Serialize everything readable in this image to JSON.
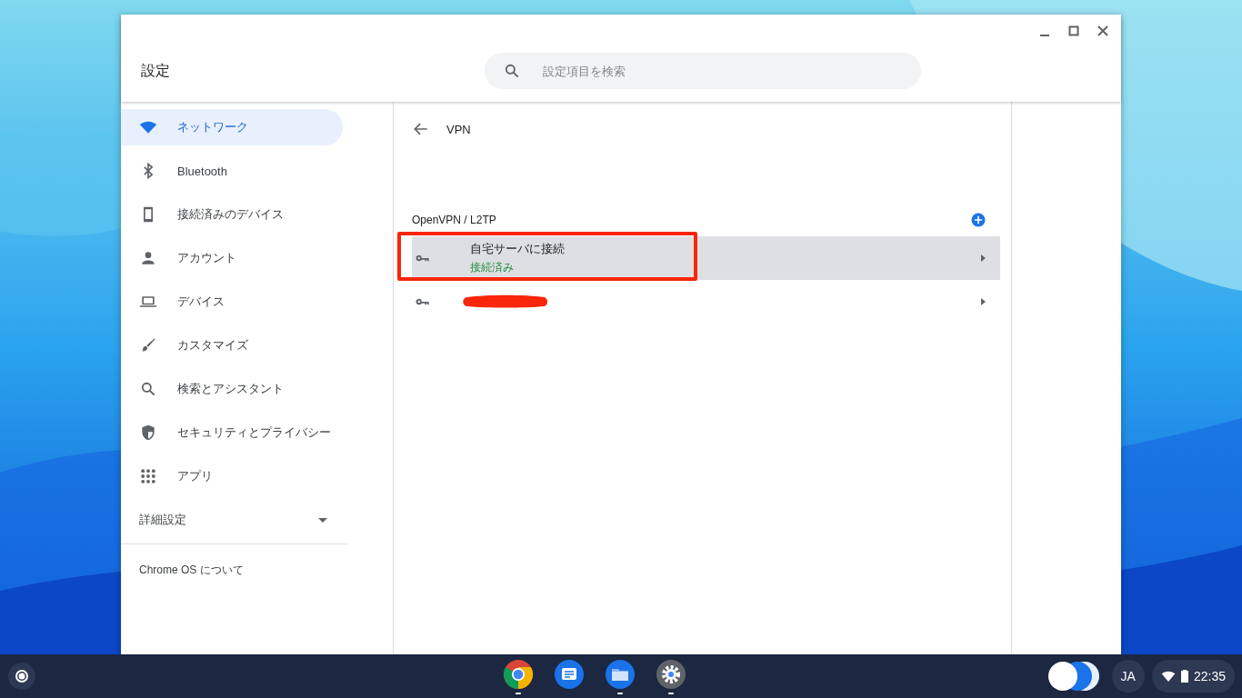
{
  "window": {
    "title": "設定",
    "search": {
      "placeholder": "設定項目を検索"
    }
  },
  "sidebar": {
    "items": [
      {
        "label": "ネットワーク",
        "kind": "wifi",
        "selected": true
      },
      {
        "label": "Bluetooth",
        "kind": "bluetooth",
        "selected": false
      },
      {
        "label": "接続済みのデバイス",
        "kind": "phone",
        "selected": false
      },
      {
        "label": "アカウント",
        "kind": "person",
        "selected": false
      },
      {
        "label": "デバイス",
        "kind": "laptop",
        "selected": false
      },
      {
        "label": "カスタマイズ",
        "kind": "brush",
        "selected": false
      },
      {
        "label": "検索とアシスタント",
        "kind": "search",
        "selected": false
      },
      {
        "label": "セキュリティとプライバシー",
        "kind": "shield",
        "selected": false
      },
      {
        "label": "アプリ",
        "kind": "apps",
        "selected": false
      }
    ],
    "advanced": {
      "label": "詳細設定",
      "expanded": false
    },
    "about": "Chrome OS について"
  },
  "page": {
    "title": "VPN",
    "section": "OpenVPN / L2TP",
    "networks": [
      {
        "name": "自宅サーバに接続",
        "status": "接続済み",
        "selected": true,
        "annotated": true,
        "redacted": false
      },
      {
        "selected": false,
        "annotated": false,
        "redacted": true
      }
    ]
  },
  "shelf": {
    "apps": [
      {
        "kind": "chrome",
        "running": true
      },
      {
        "kind": "messages",
        "running": false
      },
      {
        "kind": "files",
        "running": true
      },
      {
        "kind": "settings",
        "running": true
      }
    ],
    "ime": "JA",
    "time": "22:35"
  }
}
